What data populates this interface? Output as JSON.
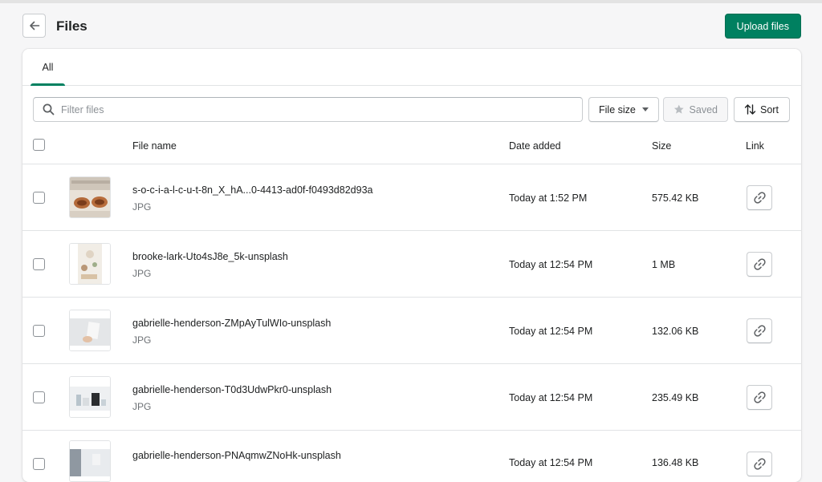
{
  "header": {
    "title": "Files",
    "upload_label": "Upload files"
  },
  "tabs": [
    {
      "label": "All",
      "active": true
    }
  ],
  "filters": {
    "search_placeholder": "Filter files",
    "file_size_label": "File size",
    "saved_label": "Saved",
    "sort_label": "Sort"
  },
  "table": {
    "columns": {
      "name": "File name",
      "date": "Date added",
      "size": "Size",
      "link": "Link"
    },
    "rows": [
      {
        "name": "s-o-c-i-a-l-c-u-t-8n_X_hA...0-4413-ad0f-f0493d82d93a",
        "type": "JPG",
        "date": "Today at 1:52 PM",
        "size": "575.42 KB",
        "thumbnail": "shoes-on-wood-photo"
      },
      {
        "name": "brooke-lark-Uto4sJ8e_5k-unsplash",
        "type": "JPG",
        "date": "Today at 12:54 PM",
        "size": "1 MB",
        "thumbnail": "flatlay-photo"
      },
      {
        "name": "gabrielle-henderson-ZMpAyTulWIo-unsplash",
        "type": "JPG",
        "date": "Today at 12:54 PM",
        "size": "132.06 KB",
        "thumbnail": "hand-holding-card-photo"
      },
      {
        "name": "gabrielle-henderson-T0d3UdwPkr0-unsplash",
        "type": "JPG",
        "date": "Today at 12:54 PM",
        "size": "235.49 KB",
        "thumbnail": "desk-objects-photo"
      },
      {
        "name": "gabrielle-henderson-PNAqmwZNoHk-unsplash",
        "type": "",
        "date": "Today at 12:54 PM",
        "size": "136.48 KB",
        "thumbnail": "white-room-photo"
      }
    ]
  },
  "colors": {
    "primary": "#008060",
    "border": "#c9cccf",
    "divider": "#e1e3e5",
    "muted_text": "#6d7175",
    "background": "#f6f6f7"
  },
  "icons": {
    "back": "arrow-left-icon",
    "search": "search-icon",
    "caret": "caret-down-icon",
    "saved": "star-icon",
    "sort": "sort-arrows-icon",
    "link": "link-icon"
  }
}
